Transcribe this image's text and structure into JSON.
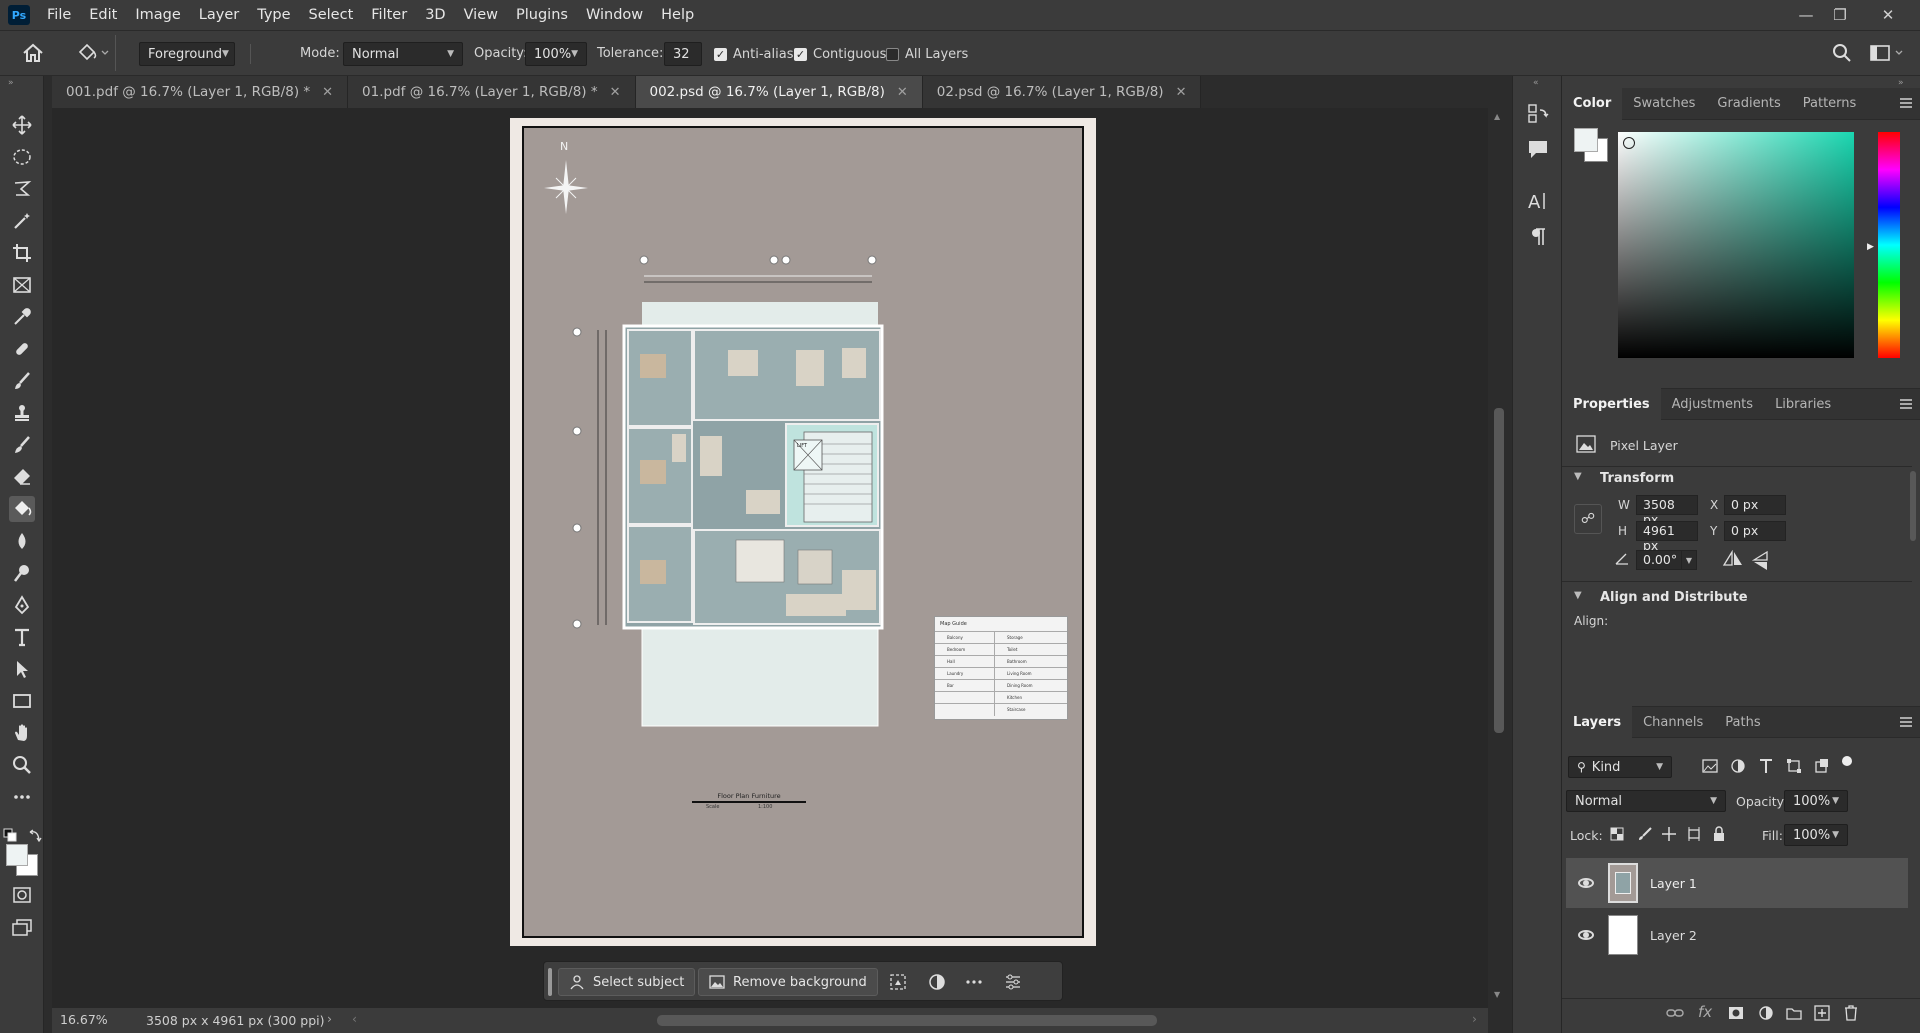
{
  "app": {
    "logo": "Ps"
  },
  "menu": [
    "File",
    "Edit",
    "Image",
    "Layer",
    "Type",
    "Select",
    "Filter",
    "3D",
    "View",
    "Plugins",
    "Window",
    "Help"
  ],
  "options": {
    "fill_source": "Foreground",
    "mode_label": "Mode:",
    "mode_value": "Normal",
    "opacity_label": "Opacity:",
    "opacity_value": "100%",
    "tolerance_label": "Tolerance:",
    "tolerance_value": "32",
    "anti_alias": "Anti-alias",
    "contiguous": "Contiguous",
    "all_layers": "All Layers"
  },
  "tabs": [
    {
      "label": "001.pdf @ 16.7% (Layer 1, RGB/8) *",
      "active": false
    },
    {
      "label": "01.pdf @ 16.7% (Layer 1, RGB/8) *",
      "active": false
    },
    {
      "label": "002.psd @ 16.7% (Layer 1, RGB/8)",
      "active": true
    },
    {
      "label": "02.psd @ 16.7% (Layer 1, RGB/8)",
      "active": false
    }
  ],
  "document": {
    "north": "N",
    "plan_title": "Floor Plan Furniture",
    "scale_label": "Scale",
    "scale_value": "1:100",
    "map_guide_title": "Map Guide",
    "lift": "LIFT",
    "map_guide_rows": [
      {
        "a": "Balcony",
        "b": "Storage"
      },
      {
        "a": "Bedroom",
        "b": "Toilet"
      },
      {
        "a": "Hall",
        "b": "Bathroom"
      },
      {
        "a": "Laundry",
        "b": "Living Room"
      },
      {
        "a": "Bar",
        "b": "Dining Room"
      },
      {
        "a": "",
        "b": "Kitchen"
      },
      {
        "a": "",
        "b": "Staircase"
      }
    ]
  },
  "taskbar": {
    "select_subject": "Select subject",
    "remove_background": "Remove background"
  },
  "status": {
    "zoom": "16.67%",
    "doc_info": "3508 px x 4961 px (300 ppi)"
  },
  "color_panel": {
    "tabs": [
      "Color",
      "Swatches",
      "Gradients",
      "Patterns"
    ],
    "foreground": "#eef3f3",
    "background": "#ffffff"
  },
  "properties_panel": {
    "tabs": [
      "Properties",
      "Adjustments",
      "Libraries"
    ],
    "layer_kind": "Pixel Layer",
    "transform_title": "Transform",
    "w_label": "W",
    "w_value": "3508 px",
    "h_label": "H",
    "h_value": "4961 px",
    "x_label": "X",
    "x_value": "0 px",
    "y_label": "Y",
    "y_value": "0 px",
    "angle_value": "0.00°",
    "align_title": "Align and Distribute",
    "align_label": "Align:"
  },
  "layers_panel": {
    "tabs": [
      "Layers",
      "Channels",
      "Paths"
    ],
    "filter_kind": "Kind",
    "blend_mode": "Normal",
    "opacity_label": "Opacity:",
    "opacity_value": "100%",
    "lock_label": "Lock:",
    "fill_label": "Fill:",
    "fill_value": "100%",
    "layers": [
      {
        "name": "Layer 1",
        "selected": true
      },
      {
        "name": "Layer 2",
        "selected": false
      }
    ]
  }
}
